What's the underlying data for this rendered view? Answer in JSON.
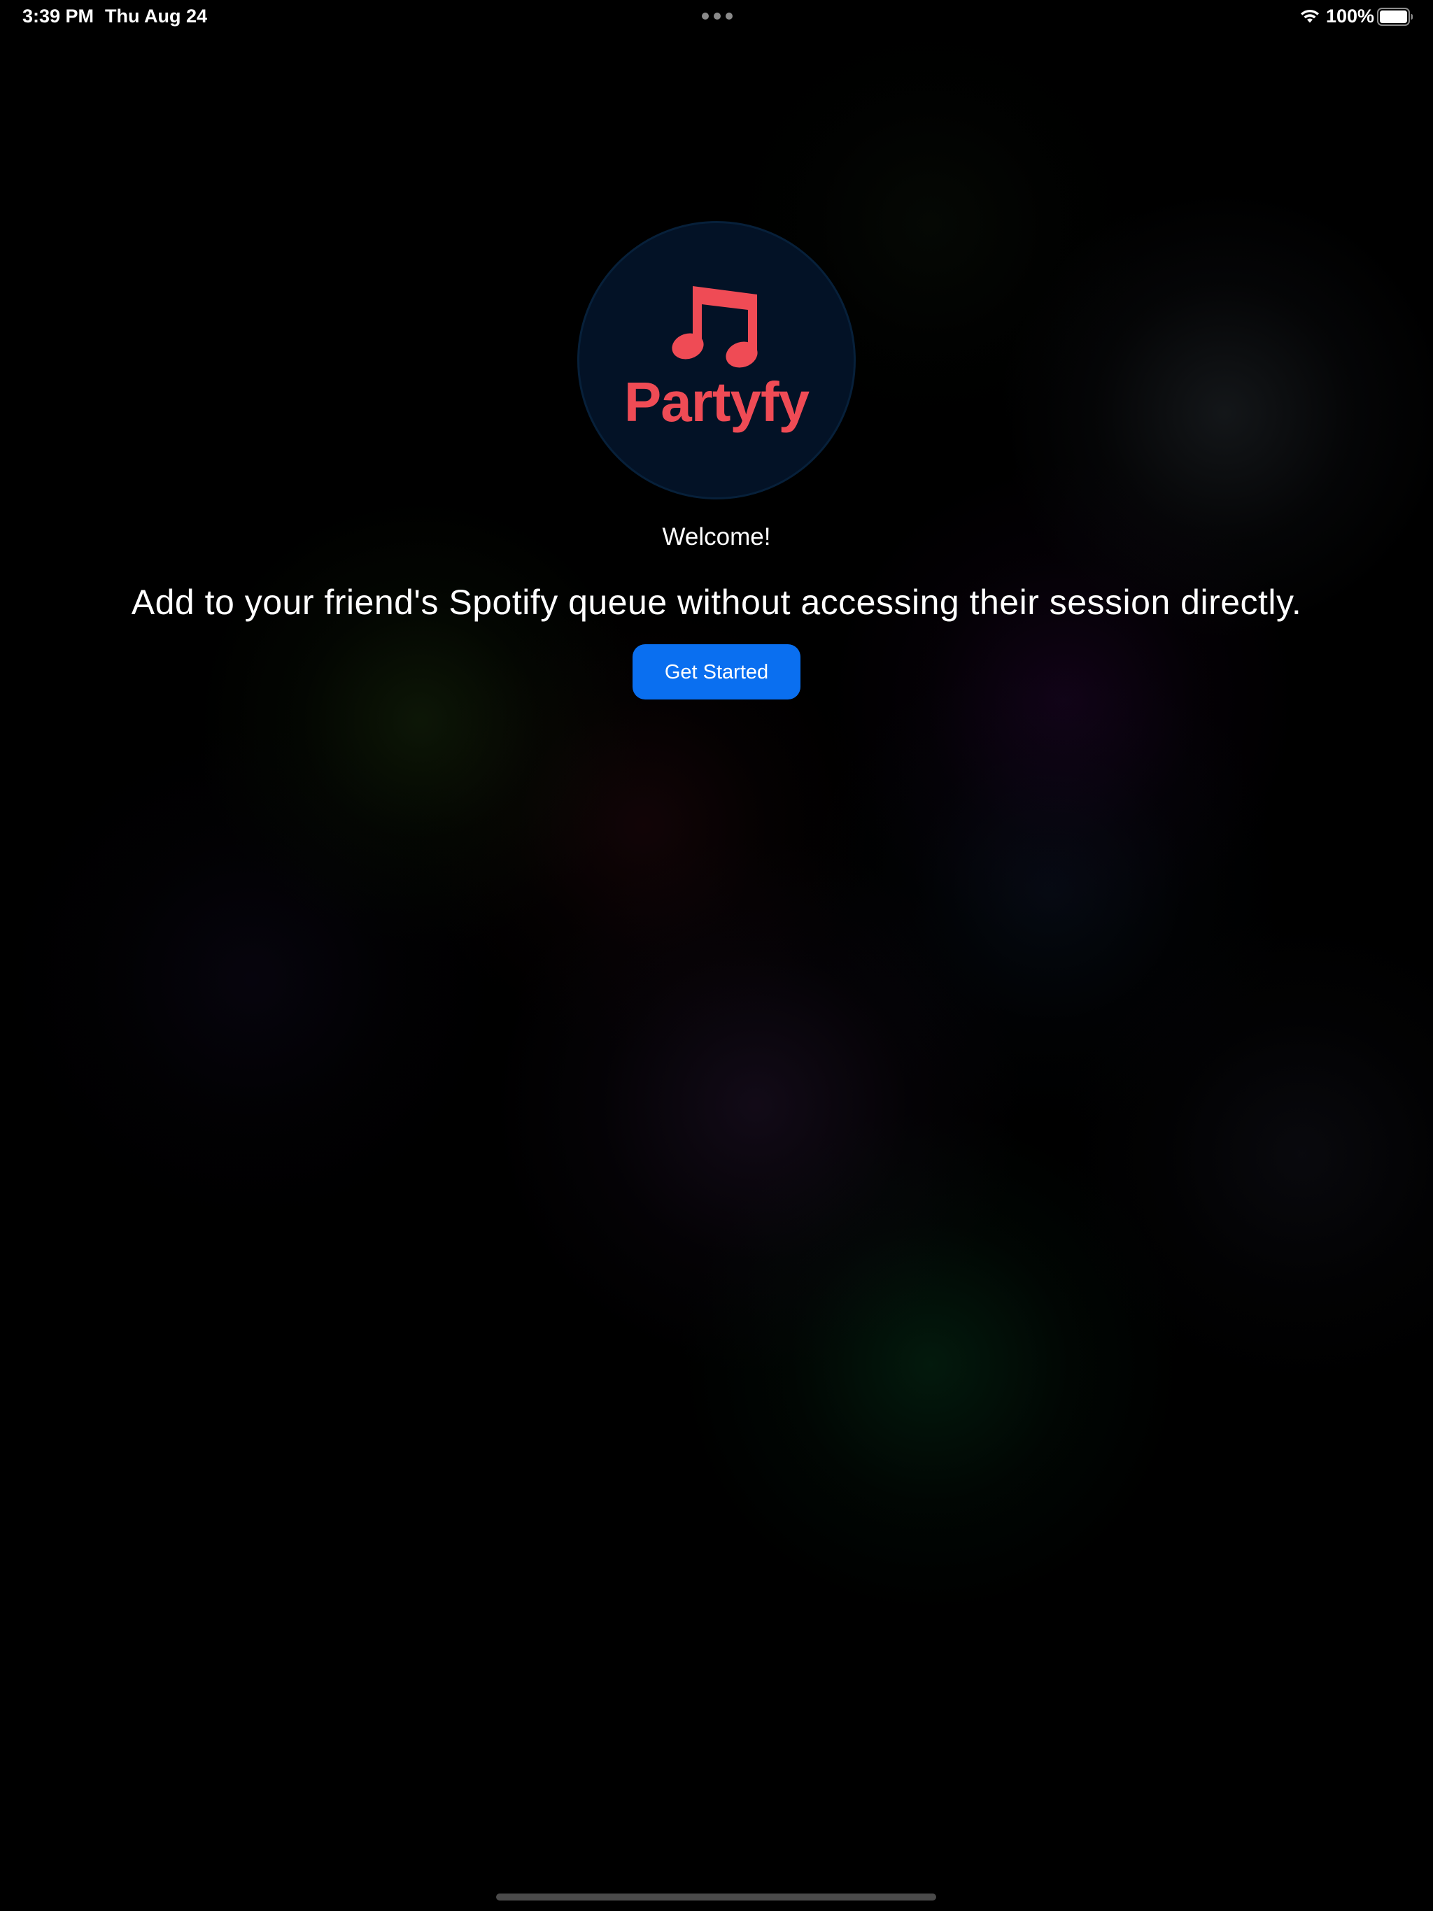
{
  "status_bar": {
    "time": "3:39 PM",
    "date": "Thu Aug 24",
    "battery_percent": "100%",
    "battery_level": 1.0,
    "icons": [
      "multitask-dots-icon",
      "wifi-icon",
      "battery-icon"
    ]
  },
  "logo": {
    "app_name": "Partyfy",
    "icon": "music-note-icon",
    "circle_color": "#031226",
    "accent_color": "#ef4b55"
  },
  "welcome": {
    "title": "Welcome!",
    "tagline": "Add to your friend's Spotify queue without accessing their session directly.",
    "get_started_label": "Get Started",
    "button_color": "#0a6ff0"
  }
}
